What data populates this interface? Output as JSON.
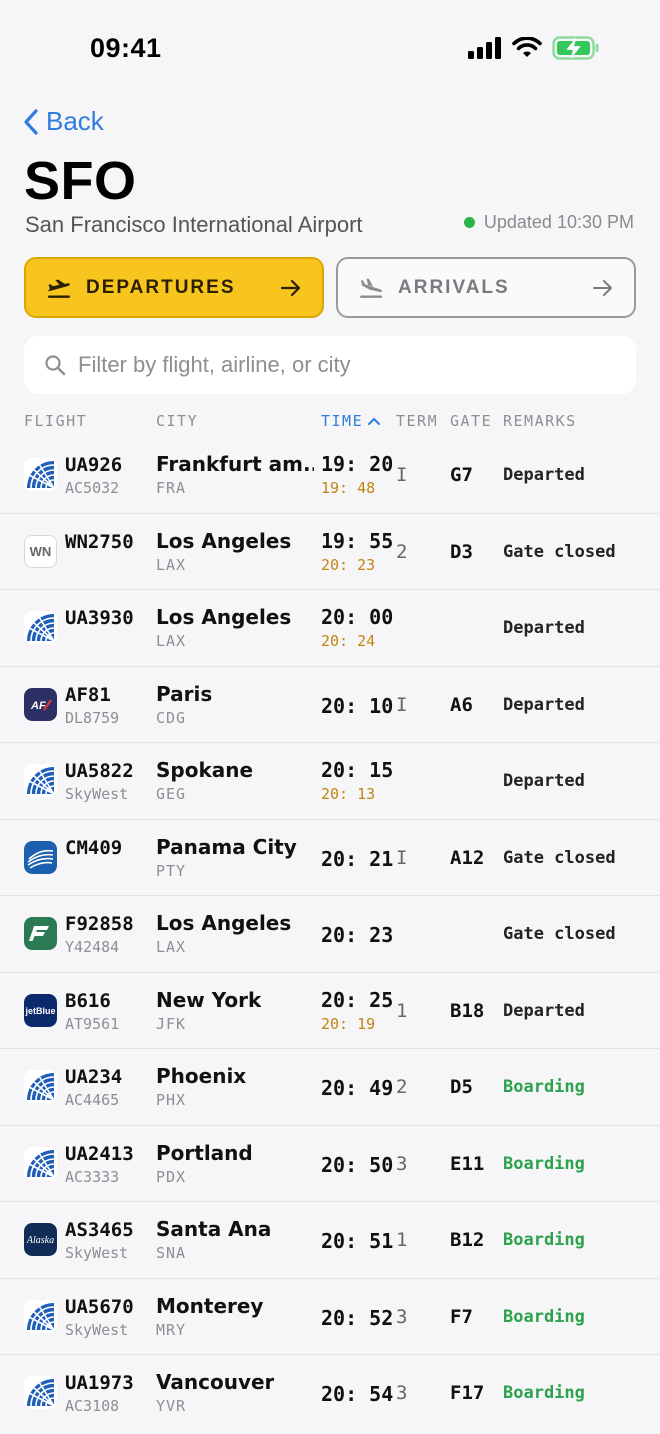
{
  "status_bar": {
    "time": "09:41"
  },
  "nav": {
    "back_label": "Back"
  },
  "airport": {
    "code": "SFO",
    "name": "San Francisco International Airport",
    "updated": "Updated 10:30 PM"
  },
  "tabs": {
    "departures": "DEPARTURES",
    "arrivals": "ARRIVALS",
    "active": "departures"
  },
  "search": {
    "placeholder": "Filter by flight, airline, or city",
    "value": ""
  },
  "columns": {
    "flight": "FLIGHT",
    "city": "CITY",
    "time": "TIME",
    "term": "TERM",
    "gate": "GATE",
    "remarks": "REMARKS",
    "sort_column": "time",
    "sort_direction": "ascending"
  },
  "colors": {
    "accent": "#2f7de1",
    "departures_tab": "#f7c51d",
    "delay": "#c08410",
    "boarding": "#2ba24b",
    "live_dot": "#2db34a"
  },
  "flights": [
    {
      "logo": "united-logo-icon",
      "flight": "UA926",
      "codeshare": "AC5032",
      "city": "Frankfurt am...",
      "iata": "FRA",
      "scheduled": "19:20",
      "estimated": "19:48",
      "term": "I",
      "gate": "G7",
      "remark": "Departed",
      "status": "departed"
    },
    {
      "logo": "southwest-logo-icon",
      "flight": "WN2750",
      "codeshare": "",
      "city": "Los Angeles",
      "iata": "LAX",
      "scheduled": "19:55",
      "estimated": "20:23",
      "term": "2",
      "gate": "D3",
      "remark": "Gate closed",
      "status": "closed"
    },
    {
      "logo": "united-logo-icon",
      "flight": "UA3930",
      "codeshare": "",
      "city": "Los Angeles",
      "iata": "LAX",
      "scheduled": "20:00",
      "estimated": "20:24",
      "term": "",
      "gate": "",
      "remark": "Departed",
      "status": "departed"
    },
    {
      "logo": "airfrance-logo-icon",
      "flight": "AF81",
      "codeshare": "DL8759",
      "city": "Paris",
      "iata": "CDG",
      "scheduled": "20:10",
      "estimated": "",
      "term": "I",
      "gate": "A6",
      "remark": "Departed",
      "status": "departed"
    },
    {
      "logo": "united-logo-icon",
      "flight": "UA5822",
      "codeshare": "SkyWest",
      "city": "Spokane",
      "iata": "GEG",
      "scheduled": "20:15",
      "estimated": "20:13",
      "term": "",
      "gate": "",
      "remark": "Departed",
      "status": "departed"
    },
    {
      "logo": "copa-logo-icon",
      "flight": "CM409",
      "codeshare": "",
      "city": "Panama City",
      "iata": "PTY",
      "scheduled": "20:21",
      "estimated": "",
      "term": "I",
      "gate": "A12",
      "remark": "Gate closed",
      "status": "closed"
    },
    {
      "logo": "frontier-logo-icon",
      "flight": "F92858",
      "codeshare": "Y42484",
      "city": "Los Angeles",
      "iata": "LAX",
      "scheduled": "20:23",
      "estimated": "",
      "term": "",
      "gate": "",
      "remark": "Gate closed",
      "status": "closed"
    },
    {
      "logo": "jetblue-logo-icon",
      "flight": "B616",
      "codeshare": "AT9561",
      "city": "New York",
      "iata": "JFK",
      "scheduled": "20:25",
      "estimated": "20:19",
      "term": "1",
      "gate": "B18",
      "remark": "Departed",
      "status": "departed"
    },
    {
      "logo": "united-logo-icon",
      "flight": "UA234",
      "codeshare": "AC4465",
      "city": "Phoenix",
      "iata": "PHX",
      "scheduled": "20:49",
      "estimated": "",
      "term": "2",
      "gate": "D5",
      "remark": "Boarding",
      "status": "boarding"
    },
    {
      "logo": "united-logo-icon",
      "flight": "UA2413",
      "codeshare": "AC3333",
      "city": "Portland",
      "iata": "PDX",
      "scheduled": "20:50",
      "estimated": "",
      "term": "3",
      "gate": "E11",
      "remark": "Boarding",
      "status": "boarding"
    },
    {
      "logo": "alaska-logo-icon",
      "flight": "AS3465",
      "codeshare": "SkyWest",
      "city": "Santa Ana",
      "iata": "SNA",
      "scheduled": "20:51",
      "estimated": "",
      "term": "1",
      "gate": "B12",
      "remark": "Boarding",
      "status": "boarding"
    },
    {
      "logo": "united-logo-icon",
      "flight": "UA5670",
      "codeshare": "SkyWest",
      "city": "Monterey",
      "iata": "MRY",
      "scheduled": "20:52",
      "estimated": "",
      "term": "3",
      "gate": "F7",
      "remark": "Boarding",
      "status": "boarding"
    },
    {
      "logo": "united-logo-icon",
      "flight": "UA1973",
      "codeshare": "AC3108",
      "city": "Vancouver",
      "iata": "YVR",
      "scheduled": "20:54",
      "estimated": "",
      "term": "3",
      "gate": "F17",
      "remark": "Boarding",
      "status": "boarding"
    }
  ]
}
